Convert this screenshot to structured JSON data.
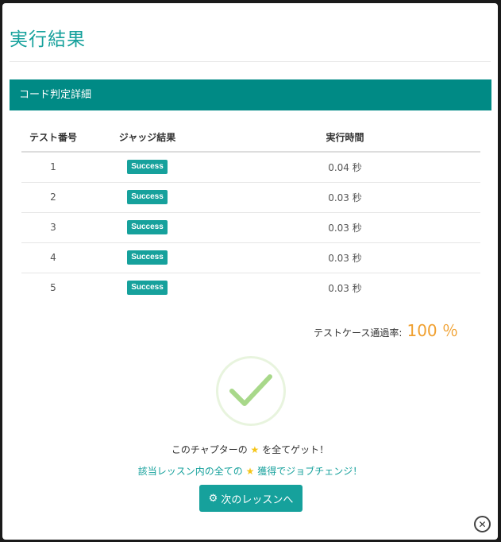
{
  "modal": {
    "title": "実行結果",
    "panel_title": "コード判定詳細"
  },
  "table": {
    "headers": {
      "number": "テスト番号",
      "judge": "ジャッジ結果",
      "time": "実行時間"
    },
    "rows": [
      {
        "number": "1",
        "judge": "Success",
        "time": "0.04 秒"
      },
      {
        "number": "2",
        "judge": "Success",
        "time": "0.03 秒"
      },
      {
        "number": "3",
        "judge": "Success",
        "time": "0.03 秒"
      },
      {
        "number": "4",
        "judge": "Success",
        "time": "0.03 秒"
      },
      {
        "number": "5",
        "judge": "Success",
        "time": "0.03 秒"
      }
    ]
  },
  "pass_rate": {
    "label": "テストケース通過率:",
    "value": "100 ％"
  },
  "messages": {
    "chapter_pre": "このチャプターの",
    "chapter_post": "を全てゲット！",
    "lesson_pre": "該当レッスン内の全ての",
    "lesson_post": "獲得でジョブチェンジ！"
  },
  "next_button_label": "次のレッスンへ",
  "icons": {
    "check": "check-icon",
    "star": "star-icon",
    "gear": "gear-icon",
    "close": "close-icon"
  },
  "colors": {
    "accent": "#16a19c",
    "panel": "#008a85",
    "pass_rate": "#f0a030",
    "star": "#f5c518",
    "check": "#a8d88a"
  }
}
